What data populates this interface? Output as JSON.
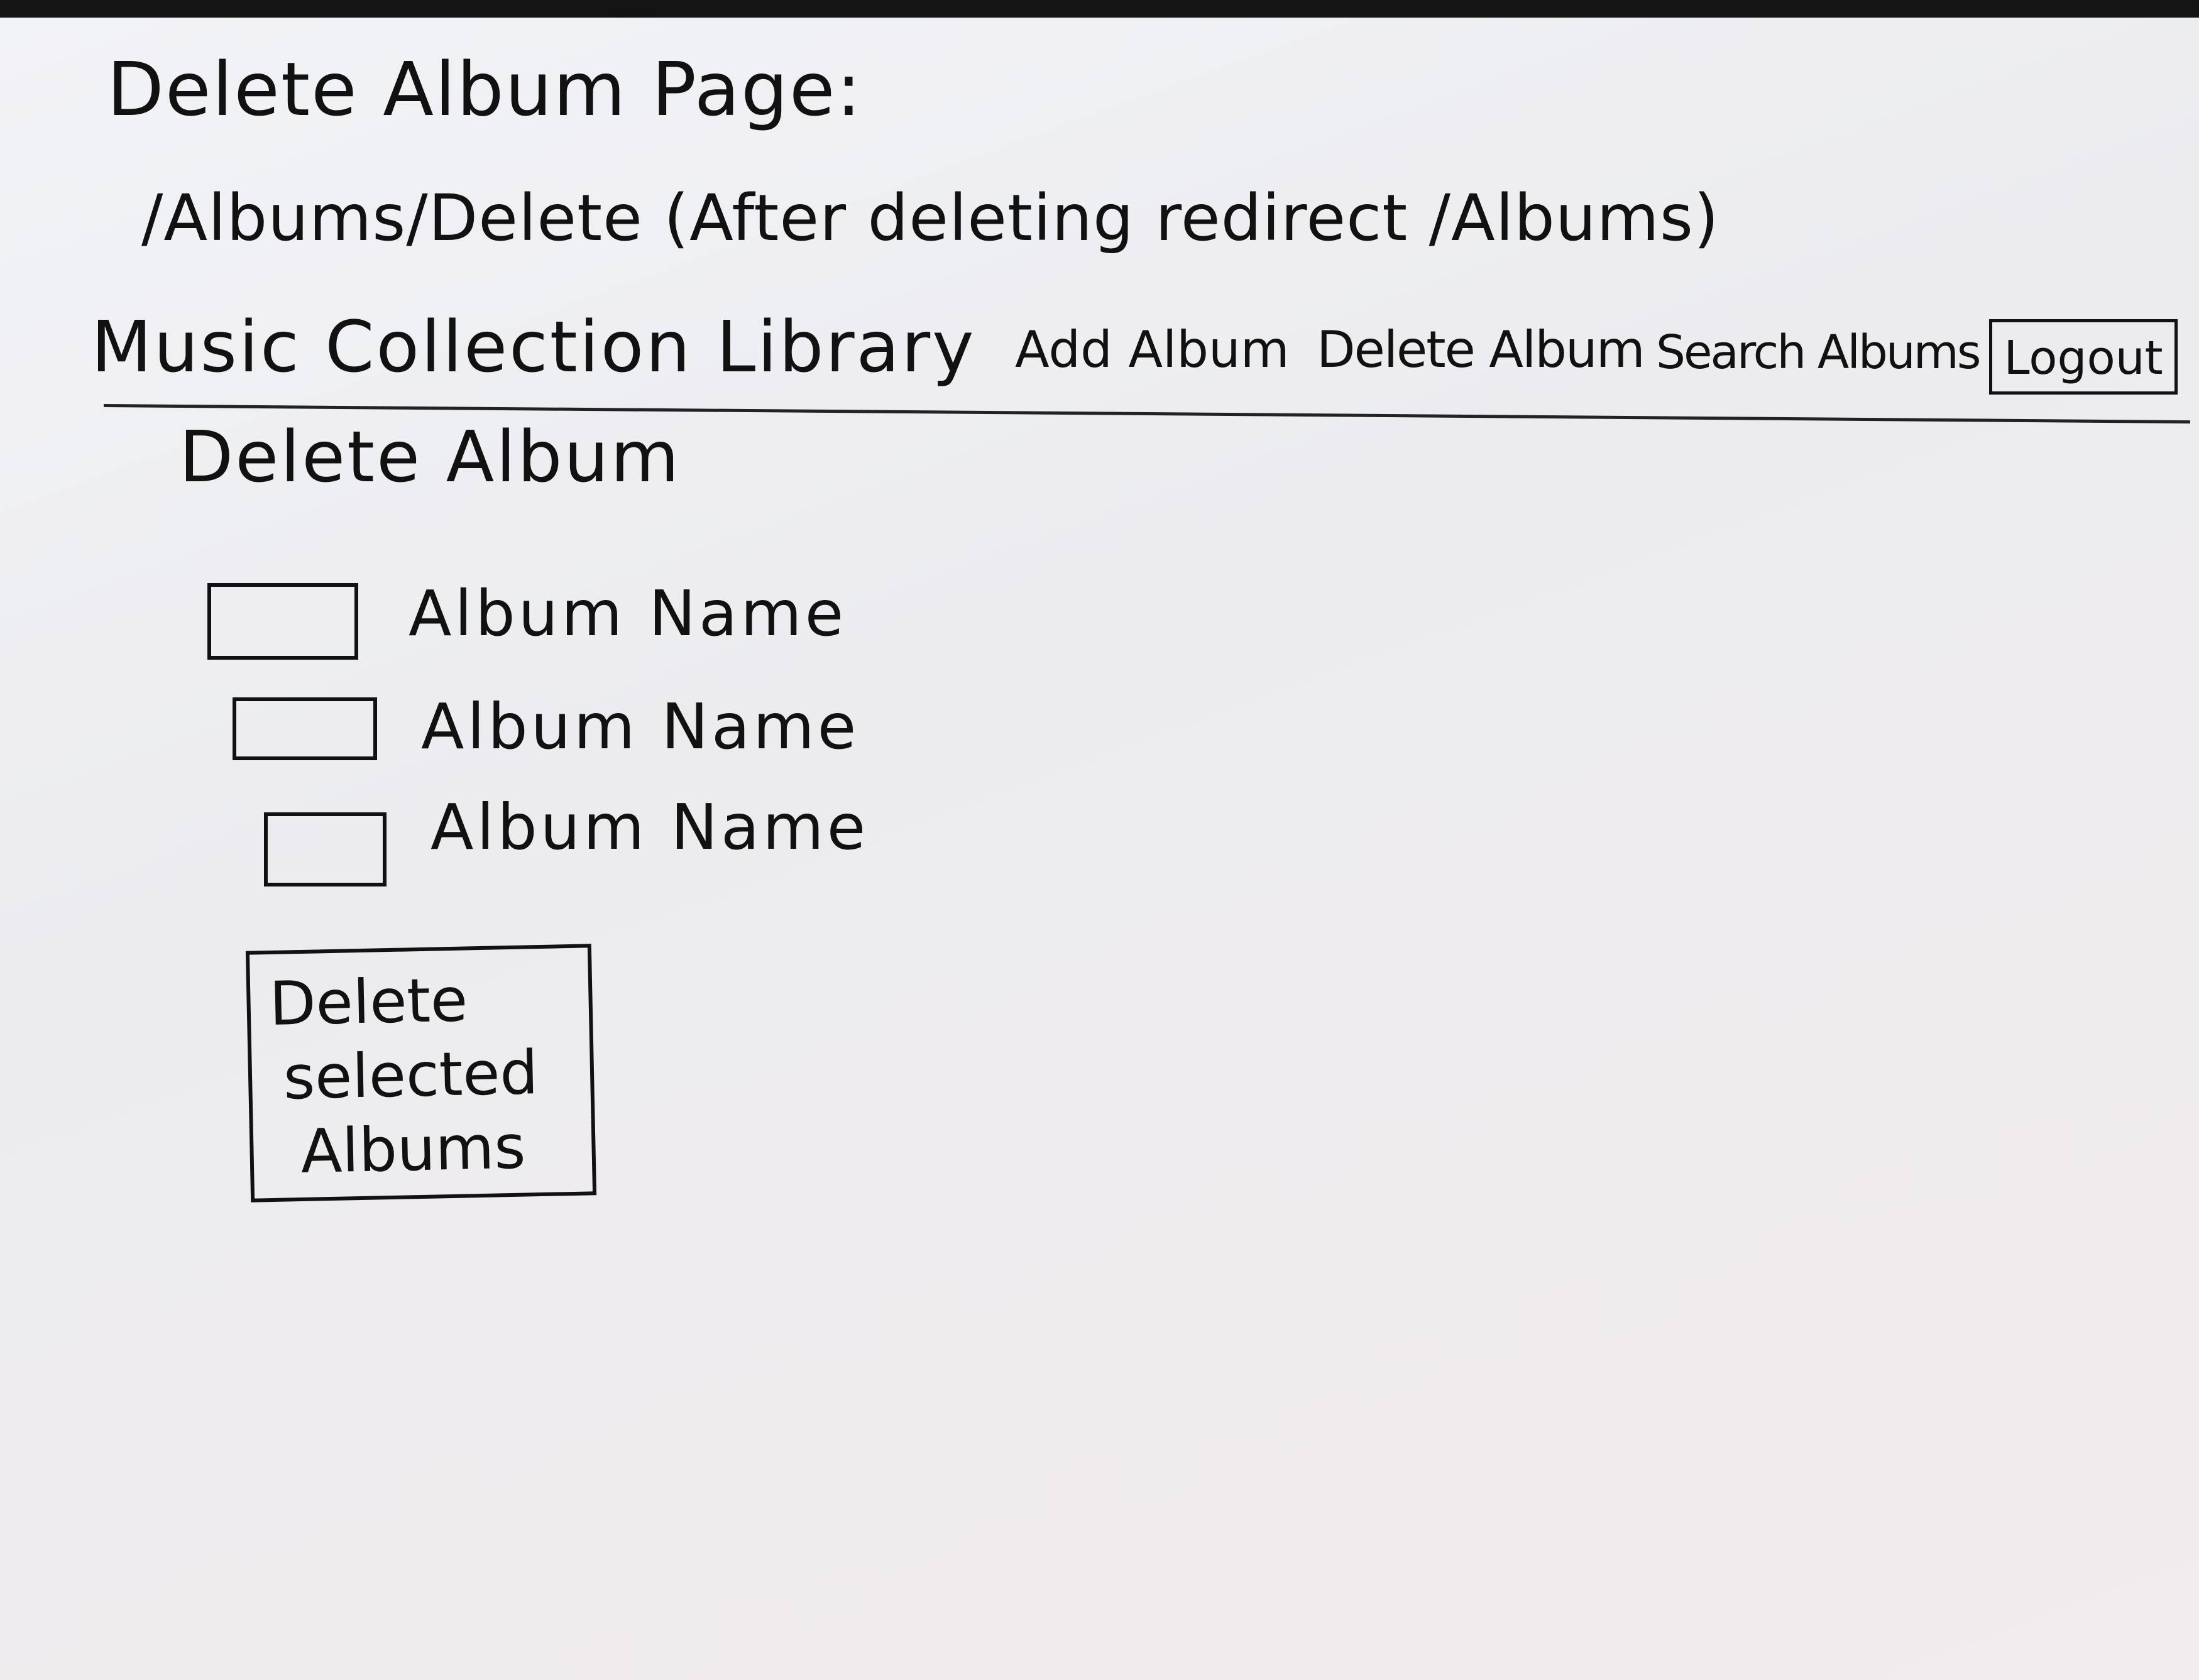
{
  "page": {
    "heading": "Delete Album Page:",
    "route": "/Albums/Delete (After deleting redirect /Albums)"
  },
  "navbar": {
    "brand": "Music Collection Library",
    "links": [
      {
        "label": "Add Album"
      },
      {
        "label": "Delete Album"
      },
      {
        "label": "Search Albums"
      }
    ],
    "logout_label": "Logout"
  },
  "main": {
    "title": "Delete Album",
    "albums": [
      {
        "name": "Album Name",
        "checked": false
      },
      {
        "name": "Album Name",
        "checked": false
      },
      {
        "name": "Album Name",
        "checked": false
      }
    ],
    "delete_button": {
      "lines": [
        "Delete",
        "selected",
        "Albums"
      ]
    }
  }
}
